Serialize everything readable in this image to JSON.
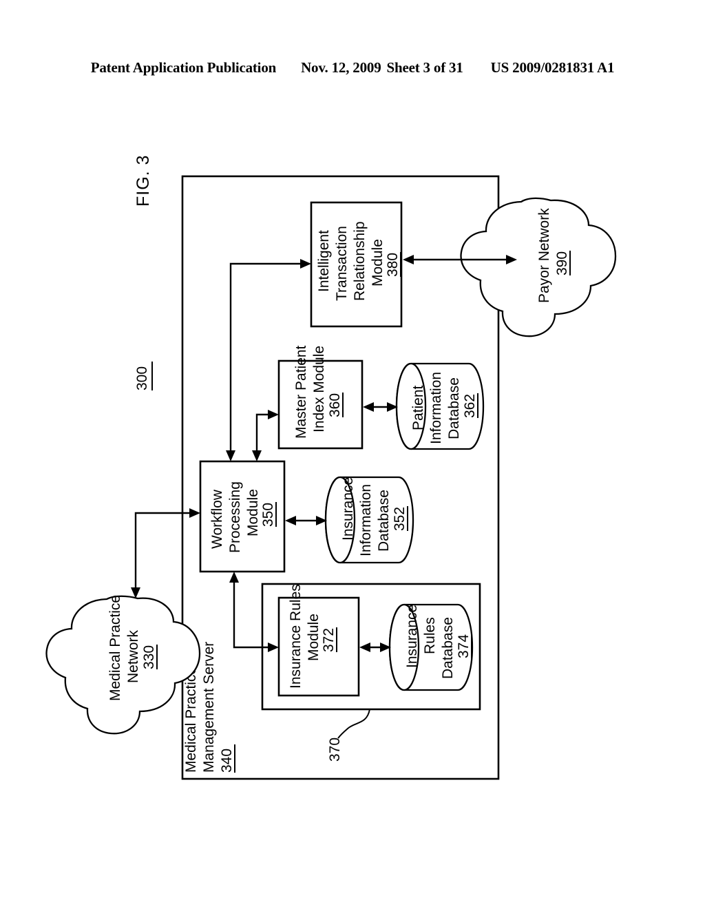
{
  "header": {
    "publication": "Patent Application Publication",
    "date": "Nov. 12, 2009",
    "sheet": "Sheet 3 of 31",
    "document_number": "US 2009/0281831 A1"
  },
  "figure": {
    "label": "FIG. 3",
    "system_ref": "300"
  },
  "server_container": {
    "title_line1": "Medical Practice",
    "title_line2": "Management Server",
    "ref": "340"
  },
  "nodes": {
    "itr_module": {
      "line1": "Intelligent",
      "line2": "Transaction",
      "line3": "Relationship",
      "line4": "Module",
      "ref": "380"
    },
    "payor_network": {
      "line1": "Payor Network",
      "ref": "390"
    },
    "master_patient_index": {
      "line1": "Master Patient",
      "line2": "Index Module",
      "ref": "360"
    },
    "patient_information_database": {
      "line1": "Patient",
      "line2": "Information",
      "line3": "Database",
      "ref": "362"
    },
    "workflow_processing": {
      "line1": "Workflow",
      "line2": "Processing",
      "line3": "Module",
      "ref": "350"
    },
    "insurance_information_database": {
      "line1": "Insurance",
      "line2": "Information",
      "line3": "Database",
      "ref": "352"
    },
    "insurance_rules_group": {
      "ref": "370"
    },
    "insurance_rules_module": {
      "line1": "Insurance Rules",
      "line2": "Module",
      "ref": "372"
    },
    "insurance_rules_database": {
      "line1": "Insurance",
      "line2": "Rules",
      "line3": "Database",
      "ref": "374"
    },
    "medical_practice_network": {
      "line1": "Medical Practice",
      "line2": "Network",
      "ref": "330"
    }
  },
  "colors": {
    "ink": "#000000",
    "paper": "#ffffff"
  }
}
